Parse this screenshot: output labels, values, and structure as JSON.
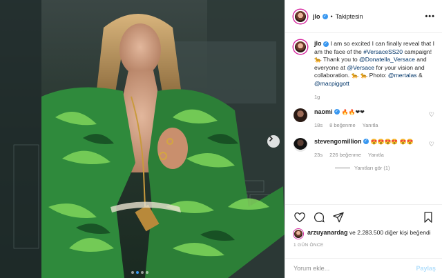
{
  "header": {
    "username": "jlo",
    "separator": "•",
    "follow_label": "Takiptesin",
    "more": "•••"
  },
  "caption": {
    "username": "jlo",
    "text_1": "I am so excited I can finally reveal that I am the face of the",
    "hashtag": "#VersaceSS20",
    "text_2": "campaign! 🐆 Thank you to",
    "mention_1": "@Donatella_Versace",
    "text_3": "and everyone at",
    "mention_2": "@Versace",
    "text_4": "for your vision and collaboration. 🐆 🐆 Photo:",
    "mention_3": "@mertalas",
    "amp": "&",
    "mention_4": "@macpiggott",
    "age": "1g"
  },
  "comments": [
    {
      "username": "naomi",
      "text": "🔥🔥❤❤",
      "age": "18s",
      "likes": "8 beğenme",
      "reply": "Yanıtla"
    },
    {
      "username": "stevengomillion",
      "text": "😍😍😍😍 😍😍",
      "age": "23s",
      "likes": "226 beğenme",
      "reply": "Yanıtla",
      "view_replies": "Yanıtları gör (1)"
    }
  ],
  "likes": {
    "user": "arzuyanardag",
    "rest": "ve 2.283.500 diğer kişi beğendi"
  },
  "timestamp": "1 GÜN ÖNCE",
  "add_comment": {
    "placeholder": "Yorum ekle...",
    "share": "Paylaş"
  },
  "carousel": {
    "count": 4,
    "active_index": 1
  },
  "colors": {
    "verified_blue": "#3897f0",
    "link_blue": "#003569",
    "muted_gray": "#8e8e8e",
    "share_disabled": "#b2dffc"
  },
  "icons": [
    "heart-icon",
    "comment-icon",
    "share-icon",
    "bookmark-icon",
    "chevron-right-icon",
    "verified-icon",
    "more-options-icon"
  ]
}
